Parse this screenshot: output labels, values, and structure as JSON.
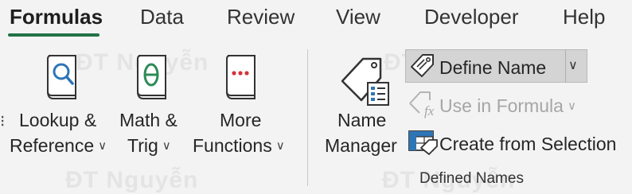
{
  "tabs": [
    {
      "label": "Formulas",
      "active": true
    },
    {
      "label": "Data"
    },
    {
      "label": "Review"
    },
    {
      "label": "View"
    },
    {
      "label": "Developer"
    },
    {
      "label": "Help"
    }
  ],
  "function_library": {
    "lookup_line1": "Lookup &",
    "lookup_line2": "Reference",
    "math_line1": "Math &",
    "math_line2": "Trig",
    "more_line1": "More",
    "more_line2": "Functions"
  },
  "defined_names": {
    "name_manager_line1": "Name",
    "name_manager_line2": "Manager",
    "define_name": "Define Name",
    "use_in_formula": "Use in Formula",
    "create_from_selection": "Create from Selection",
    "group_label": "Defined Names"
  },
  "watermark_text": "ĐT Nguyễn",
  "colors": {
    "accent": "#217346",
    "icon_blue": "#2e75b6",
    "icon_green": "#2e8b57",
    "icon_red": "#d13438"
  }
}
